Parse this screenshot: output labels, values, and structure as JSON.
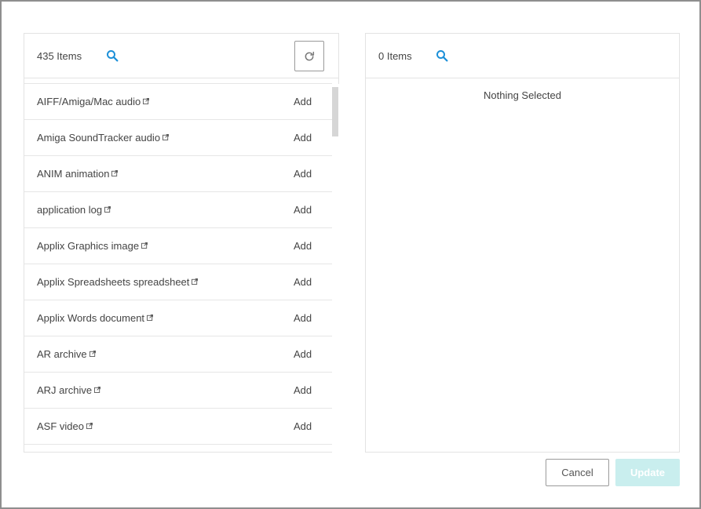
{
  "left_panel": {
    "count_label": "435 Items",
    "items": [
      {
        "label": "AIFF/Amiga/Mac audio",
        "action": "Add"
      },
      {
        "label": "Amiga SoundTracker audio",
        "action": "Add"
      },
      {
        "label": "ANIM animation",
        "action": "Add"
      },
      {
        "label": "application log",
        "action": "Add"
      },
      {
        "label": "Applix Graphics image",
        "action": "Add"
      },
      {
        "label": "Applix Spreadsheets spreadsheet",
        "action": "Add"
      },
      {
        "label": "Applix Words document",
        "action": "Add"
      },
      {
        "label": "AR archive",
        "action": "Add"
      },
      {
        "label": "ARJ archive",
        "action": "Add"
      },
      {
        "label": "ASF video",
        "action": "Add"
      }
    ]
  },
  "right_panel": {
    "count_label": "0 Items",
    "empty_message": "Nothing Selected"
  },
  "buttons": {
    "cancel": "Cancel",
    "update": "Update"
  },
  "colors": {
    "accent": "#1a8fd8",
    "update_disabled_bg": "#c9eeee",
    "border": "#e3e3e3"
  },
  "icons": {
    "search": "search-icon",
    "refresh": "refresh-icon",
    "external_link": "external-link-icon"
  }
}
